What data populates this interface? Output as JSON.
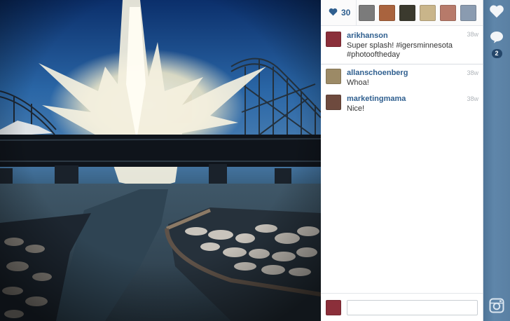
{
  "likes": {
    "count": "30",
    "avatars": [
      {
        "name": "liker-1",
        "color": "#7b7b7b"
      },
      {
        "name": "liker-2",
        "color": "#a9633e"
      },
      {
        "name": "liker-3",
        "color": "#3b3a2e"
      },
      {
        "name": "liker-4",
        "color": "#c9b58a"
      },
      {
        "name": "liker-5",
        "color": "#b77a6a"
      },
      {
        "name": "liker-6",
        "color": "#8a9bb0"
      }
    ]
  },
  "caption": {
    "username": "arikhanson",
    "text": "Super splash! #igersminnesota #photooftheday",
    "time": "38w",
    "avatar_color": "#8b2f3a"
  },
  "comments": [
    {
      "username": "allanschoenberg",
      "text": "Whoa!",
      "time": "38w",
      "avatar_color": "#9c8a66"
    },
    {
      "username": "marketingmama",
      "text": "Nice!",
      "time": "38w",
      "avatar_color": "#6e4a3e"
    }
  ],
  "compose": {
    "placeholder": "",
    "avatar_color": "#8b2f3a"
  },
  "actionbar": {
    "comment_count": "2"
  },
  "colors": {
    "link": "#2f5f8f",
    "actionbar": "#5a80a3",
    "badge": "#24466a"
  },
  "icons": {
    "like": "heart-icon",
    "comment": "speech-bubble-icon",
    "camera": "instagram-camera-icon"
  }
}
